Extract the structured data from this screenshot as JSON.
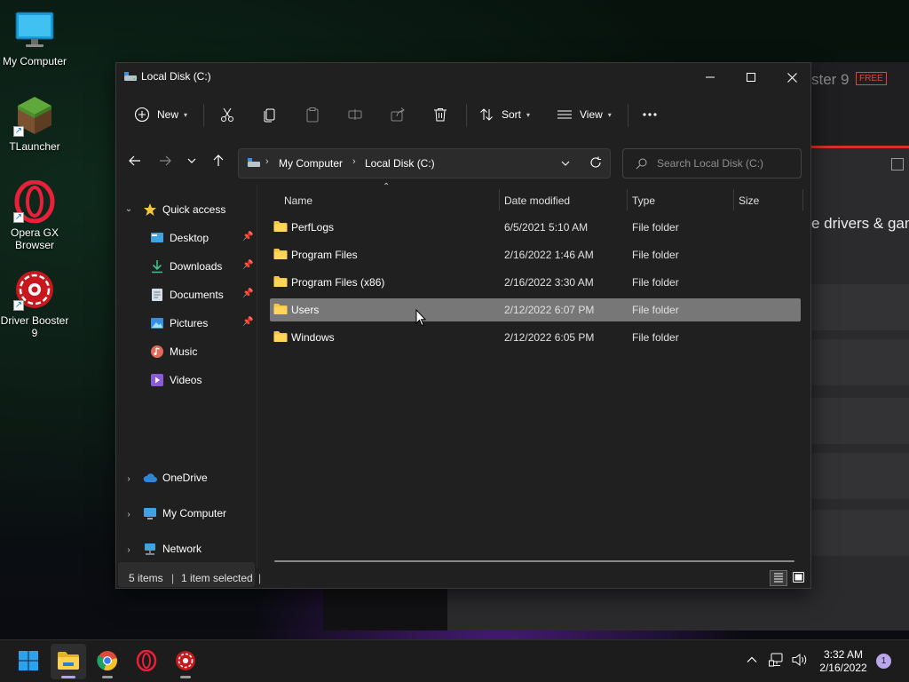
{
  "desktop": {
    "icons": [
      {
        "label": "My Computer",
        "icon": "monitor-icon"
      },
      {
        "label": "TLauncher",
        "icon": "minecraft-grass-block-icon"
      },
      {
        "label": "Opera GX Browser",
        "icon": "opera-gx-icon"
      },
      {
        "label": "Driver Booster 9",
        "icon": "driver-booster-icon"
      }
    ]
  },
  "background_app": {
    "title_fragment": "ster 9",
    "badge": "FREE",
    "headline_fragment": "e drivers & gam"
  },
  "window": {
    "title": "Local Disk (C:)",
    "caption_buttons": [
      "minimize",
      "maximize",
      "close"
    ]
  },
  "toolbar": {
    "new_label": "New",
    "sort_label": "Sort",
    "view_label": "View",
    "more_label": "...",
    "icons": [
      "cut-icon",
      "copy-icon",
      "paste-icon",
      "rename-icon",
      "share-icon",
      "delete-icon"
    ]
  },
  "address": {
    "crumbs": [
      "My Computer",
      "Local Disk (C:)"
    ],
    "search_placeholder": "Search Local Disk (C:)"
  },
  "nav_pane": {
    "quick_access": "Quick access",
    "quick_items": [
      {
        "label": "Desktop",
        "pinned": true
      },
      {
        "label": "Downloads",
        "pinned": true
      },
      {
        "label": "Documents",
        "pinned": true
      },
      {
        "label": "Pictures",
        "pinned": true
      },
      {
        "label": "Music",
        "pinned": false
      },
      {
        "label": "Videos",
        "pinned": false
      }
    ],
    "onedrive": "OneDrive",
    "my_computer": "My Computer",
    "network": "Network",
    "selected": "My Computer"
  },
  "file_list": {
    "columns": [
      "Name",
      "Date modified",
      "Type",
      "Size"
    ],
    "rows": [
      {
        "name": "PerfLogs",
        "date": "6/5/2021 5:10 AM",
        "type": "File folder",
        "size": ""
      },
      {
        "name": "Program Files",
        "date": "2/16/2022 1:46 AM",
        "type": "File folder",
        "size": ""
      },
      {
        "name": "Program Files (x86)",
        "date": "2/16/2022 3:30 AM",
        "type": "File folder",
        "size": ""
      },
      {
        "name": "Users",
        "date": "2/12/2022 6:07 PM",
        "type": "File folder",
        "size": "",
        "selected": true
      },
      {
        "name": "Windows",
        "date": "2/12/2022 6:05 PM",
        "type": "File folder",
        "size": ""
      }
    ]
  },
  "status_bar": {
    "items_count": "5 items",
    "selection": "1 item selected"
  },
  "taskbar": {
    "apps": [
      "start-icon",
      "file-explorer-icon",
      "chrome-icon",
      "opera-gx-icon",
      "driver-booster-icon"
    ],
    "active_app": "file-explorer-icon",
    "time": "3:32 AM",
    "date": "2/16/2022",
    "notification_count": "1"
  },
  "colors": {
    "window_bg": "#202020",
    "selection": "#777777",
    "folder": "#f4c542",
    "accent": "#b3a2f0"
  }
}
